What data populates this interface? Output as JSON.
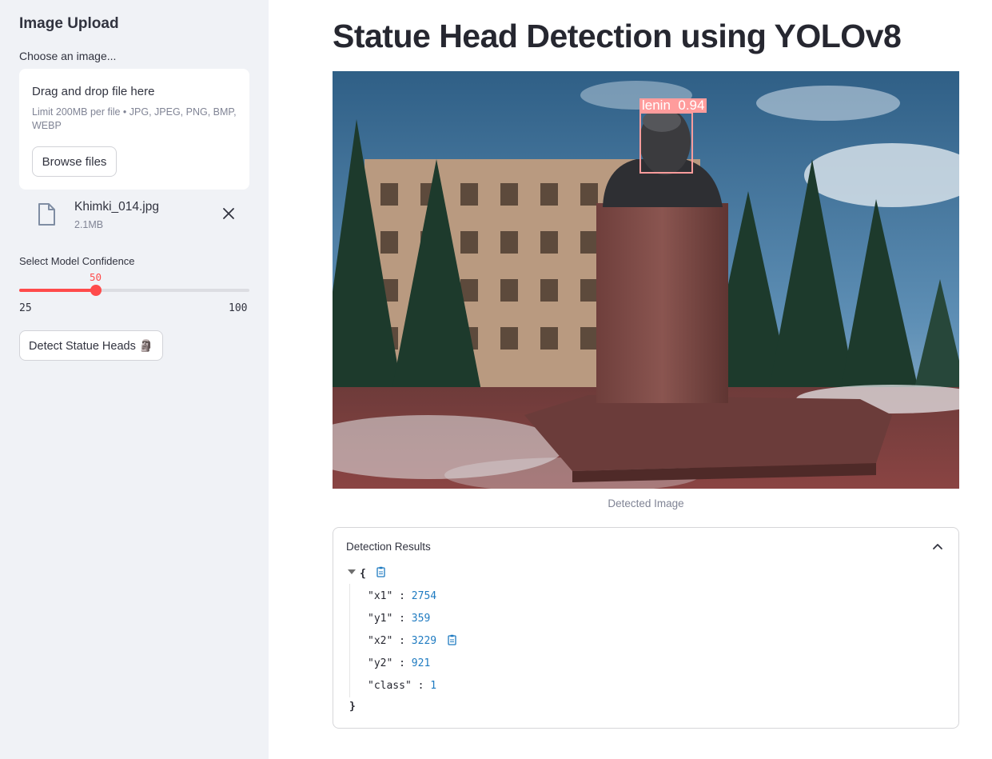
{
  "sidebar": {
    "title": "Image Upload",
    "uploader_label": "Choose an image...",
    "dropzone_title": "Drag and drop file here",
    "dropzone_limit": "Limit 200MB per file • JPG, JPEG, PNG, BMP, WEBP",
    "browse_label": "Browse files",
    "file": {
      "name": "Khimki_014.jpg",
      "size": "2.1MB"
    },
    "slider": {
      "label": "Select Model Confidence",
      "value": "50",
      "min": "25",
      "max": "100",
      "fraction": 0.3333
    },
    "detect_label": "Detect Statue Heads 🗿"
  },
  "main": {
    "title": "Statue Head Detection using YOLOv8",
    "image_label": "lenin  0.94",
    "caption": "Detected Image",
    "expander_title": "Detection Results",
    "results": [
      {
        "key": "\"x1\"",
        "value": "2754"
      },
      {
        "key": "\"y1\"",
        "value": "359"
      },
      {
        "key": "\"x2\"",
        "value": "3229"
      },
      {
        "key": "\"y2\"",
        "value": "921"
      },
      {
        "key": "\"class\"",
        "value": "1"
      }
    ],
    "open_brace": "{",
    "close_brace": "}"
  },
  "colors": {
    "accent": "#ff4b4b",
    "sidebar_bg": "#f0f2f6",
    "json_value": "#1f7bc1"
  }
}
